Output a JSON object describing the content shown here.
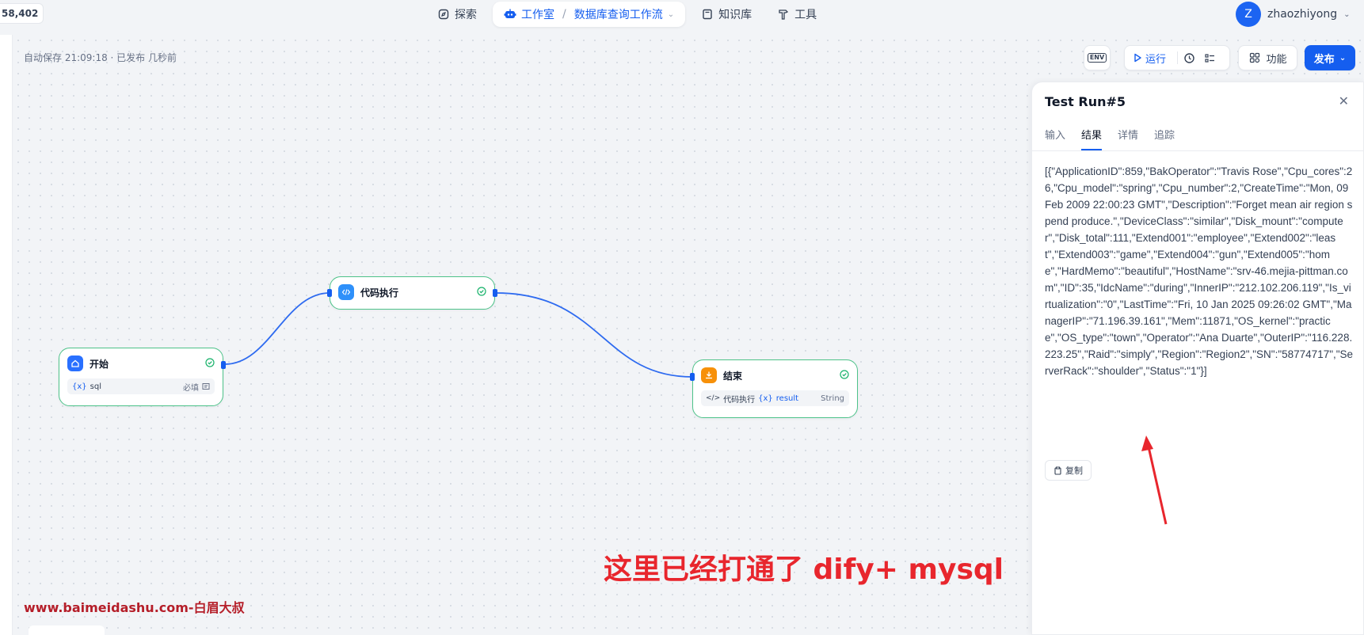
{
  "topbar": {
    "counter": "58,402",
    "nav": {
      "explore": "探索",
      "studio": "工作室",
      "separator": "/",
      "workflow_name": "数据库查询工作流",
      "knowledge": "知识库",
      "tools": "工具"
    },
    "user": {
      "initial": "Z",
      "name": "zhaozhiyong"
    }
  },
  "canvas": {
    "autosave": "自动保存 21:09:18 · 已发布 几秒前"
  },
  "toolbar": {
    "env_label": "ENV",
    "run_label": "运行",
    "features_label": "功能",
    "publish_label": "发布"
  },
  "nodes": {
    "start": {
      "title": "开始",
      "var_symbol": "{x}",
      "var_name": "sql",
      "required_label": "必填"
    },
    "code": {
      "title": "代码执行"
    },
    "end": {
      "title": "结束",
      "source_node": "代码执行",
      "var_symbol": "{x}",
      "var_name": "result",
      "type_label": "String"
    }
  },
  "panel": {
    "title": "Test Run#5",
    "tabs": [
      "输入",
      "结果",
      "详情",
      "追踪"
    ],
    "active_tab": "结果",
    "result": "[{\"ApplicationID\":859,\"BakOperator\":\"Travis Rose\",\"Cpu_cores\":26,\"Cpu_model\":\"spring\",\"Cpu_number\":2,\"CreateTime\":\"Mon, 09 Feb 2009 22:00:23 GMT\",\"Description\":\"Forget mean air region spend produce.\",\"DeviceClass\":\"similar\",\"Disk_mount\":\"computer\",\"Disk_total\":111,\"Extend001\":\"employee\",\"Extend002\":\"least\",\"Extend003\":\"game\",\"Extend004\":\"gun\",\"Extend005\":\"home\",\"HardMemo\":\"beautiful\",\"HostName\":\"srv-46.mejia-pittman.com\",\"ID\":35,\"IdcName\":\"during\",\"InnerIP\":\"212.102.206.119\",\"Is_virtualization\":\"0\",\"LastTime\":\"Fri, 10 Jan 2025 09:26:02 GMT\",\"ManagerIP\":\"71.196.39.161\",\"Mem\":11871,\"OS_kernel\":\"practice\",\"OS_type\":\"town\",\"Operator\":\"Ana Duarte\",\"OuterIP\":\"116.228.223.25\",\"Raid\":\"simply\",\"Region\":\"Region2\",\"SN\":\"58774717\",\"ServerRack\":\"shoulder\",\"Status\":\"1\"}]",
    "copy_label": "复制"
  },
  "annotations": {
    "headline": "这里已经打通了 dify+ mysql",
    "watermark": "www.baimeidashu.com-白眉大叔"
  },
  "colors": {
    "accent": "#155eef",
    "node_border": "#4ec38a",
    "annotation_red": "#e8262d",
    "watermark_red": "#b51e29"
  }
}
